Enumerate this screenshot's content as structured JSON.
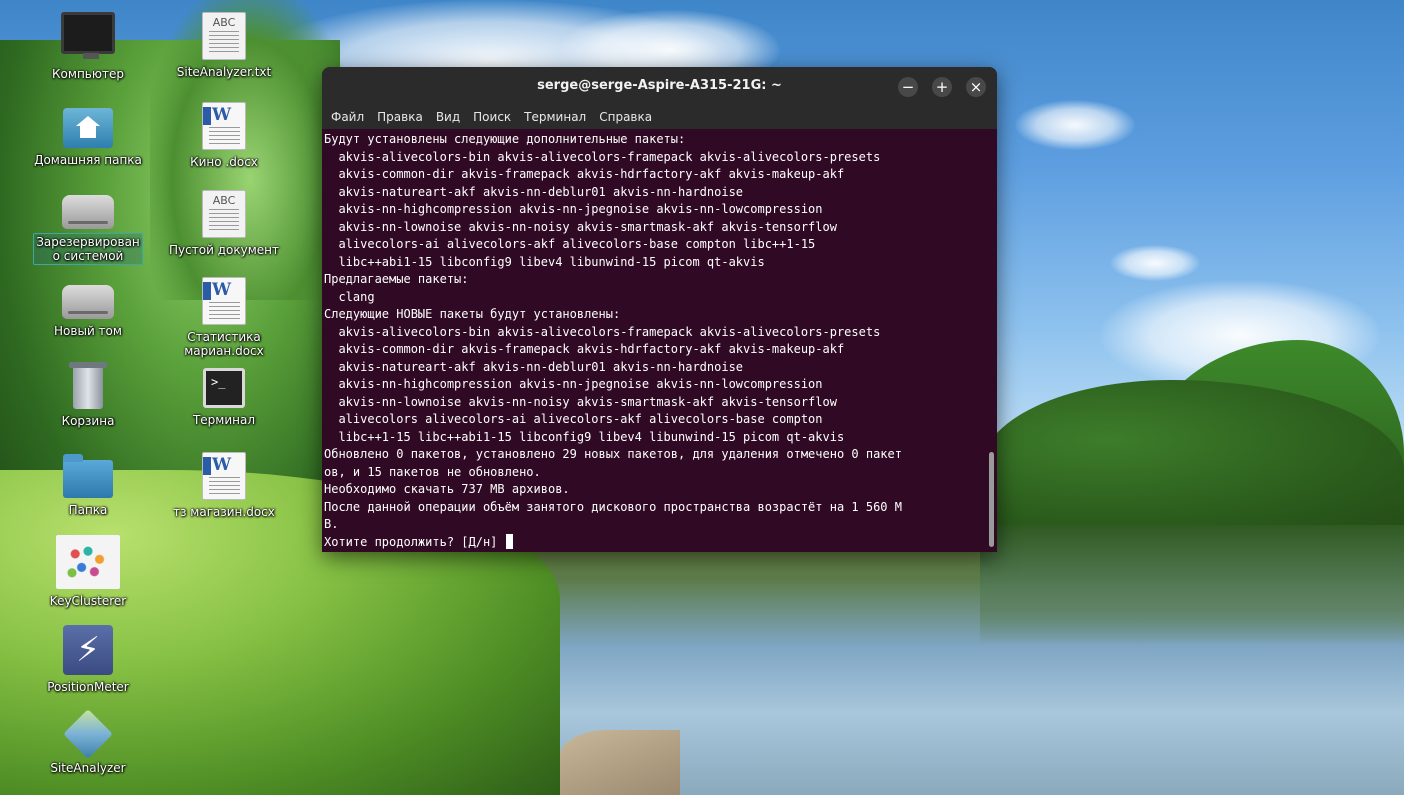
{
  "desktop": {
    "icons_left": [
      {
        "label": "Компьютер",
        "icon": "computer-icon"
      },
      {
        "label": "Домашняя папка",
        "icon": "home-folder-icon"
      },
      {
        "label": "Зарезервирован\nо системой",
        "icon": "drive-icon"
      },
      {
        "label": "Новый том",
        "icon": "drive-icon"
      },
      {
        "label": "Корзина",
        "icon": "trash-icon"
      },
      {
        "label": "Папка",
        "icon": "folder-icon"
      },
      {
        "label": "KeyClusterer",
        "icon": "keyclusterer-icon"
      },
      {
        "label": "PositionMeter",
        "icon": "positionmeter-icon"
      },
      {
        "label": "SiteAnalyzer",
        "icon": "siteanalyzer-icon"
      }
    ],
    "icons_right": [
      {
        "label": "SiteAnalyzer.txt",
        "icon": "text-file-icon",
        "badge": "ABC"
      },
      {
        "label": "Кино .docx",
        "icon": "word-doc-icon",
        "badge": "W"
      },
      {
        "label": "Пустой документ",
        "icon": "text-file-icon",
        "badge": "ABC"
      },
      {
        "label": "Статистика\nмариан.docx",
        "icon": "word-doc-icon",
        "badge": "W"
      },
      {
        "label": "Терминал",
        "icon": "terminal-icon",
        "badge": ">_"
      },
      {
        "label": "тз магазин.docx",
        "icon": "word-doc-icon",
        "badge": "W"
      }
    ]
  },
  "terminal": {
    "title": "serge@serge-Aspire-A315-21G: ~",
    "buttons": {
      "minimize": "−",
      "maximize": "+",
      "close": "×"
    },
    "menu": [
      "Файл",
      "Правка",
      "Вид",
      "Поиск",
      "Терминал",
      "Справка"
    ],
    "lines": [
      "Будут установлены следующие дополнительные пакеты:",
      "  akvis-alivecolors-bin akvis-alivecolors-framepack akvis-alivecolors-presets",
      "  akvis-common-dir akvis-framepack akvis-hdrfactory-akf akvis-makeup-akf",
      "  akvis-natureart-akf akvis-nn-deblur01 akvis-nn-hardnoise",
      "  akvis-nn-highcompression akvis-nn-jpegnoise akvis-nn-lowcompression",
      "  akvis-nn-lownoise akvis-nn-noisy akvis-smartmask-akf akvis-tensorflow",
      "  alivecolors-ai alivecolors-akf alivecolors-base compton libc++1-15",
      "  libc++abi1-15 libconfig9 libev4 libunwind-15 picom qt-akvis",
      "Предлагаемые пакеты:",
      "  clang",
      "Следующие НОВЫЕ пакеты будут установлены:",
      "  akvis-alivecolors-bin akvis-alivecolors-framepack akvis-alivecolors-presets",
      "  akvis-common-dir akvis-framepack akvis-hdrfactory-akf akvis-makeup-akf",
      "  akvis-natureart-akf akvis-nn-deblur01 akvis-nn-hardnoise",
      "  akvis-nn-highcompression akvis-nn-jpegnoise akvis-nn-lowcompression",
      "  akvis-nn-lownoise akvis-nn-noisy akvis-smartmask-akf akvis-tensorflow",
      "  alivecolors alivecolors-ai alivecolors-akf alivecolors-base compton",
      "  libc++1-15 libc++abi1-15 libconfig9 libev4 libunwind-15 picom qt-akvis",
      "Обновлено 0 пакетов, установлено 29 новых пакетов, для удаления отмечено 0 пакет",
      "ов, и 15 пакетов не обновлено.",
      "Необходимо скачать 737 MB архивов.",
      "После данной операции объём занятого дискового пространства возрастёт на 1 560 M",
      "B."
    ],
    "prompt": "Хотите продолжить? [Д/н] "
  },
  "colors": {
    "terminal_bg": "#300a24",
    "titlebar_bg": "#2b2b2b",
    "text": "#ffffff"
  }
}
